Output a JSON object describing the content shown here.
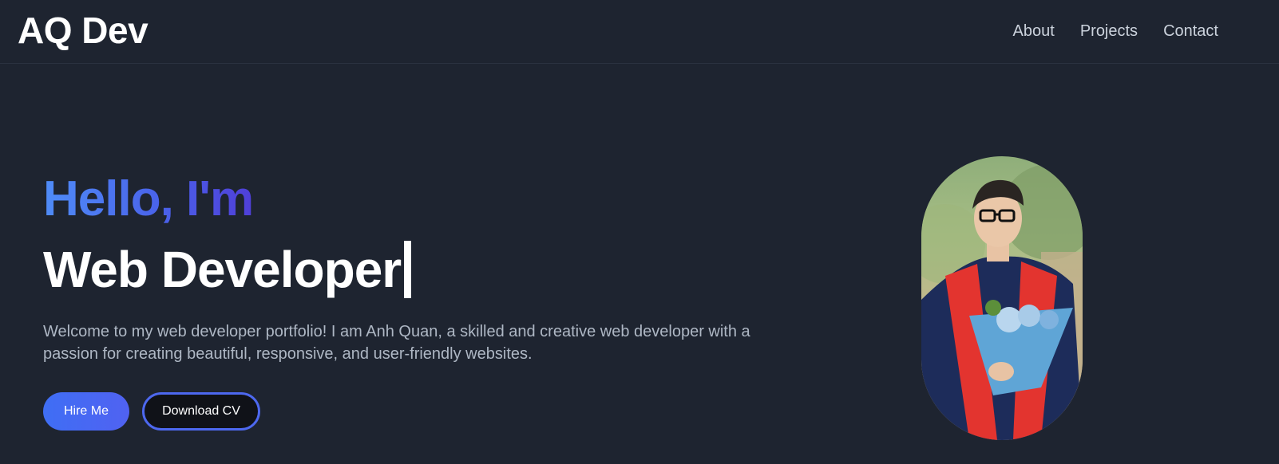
{
  "header": {
    "logo": "AQ Dev",
    "nav": [
      "About",
      "Projects",
      "Contact"
    ]
  },
  "hero": {
    "greeting": "Hello, I'm",
    "role": "Web Developer",
    "intro": "Welcome to my web developer portfolio! I am Anh Quan, a skilled and creative web developer with a passion for creating beautiful, responsive, and user-friendly websites.",
    "buttons": {
      "hire": "Hire Me",
      "cv": "Download CV"
    }
  },
  "colors": {
    "background": "#1e2430",
    "accent": "#4d68ef",
    "text_muted": "#aeb7c4"
  }
}
